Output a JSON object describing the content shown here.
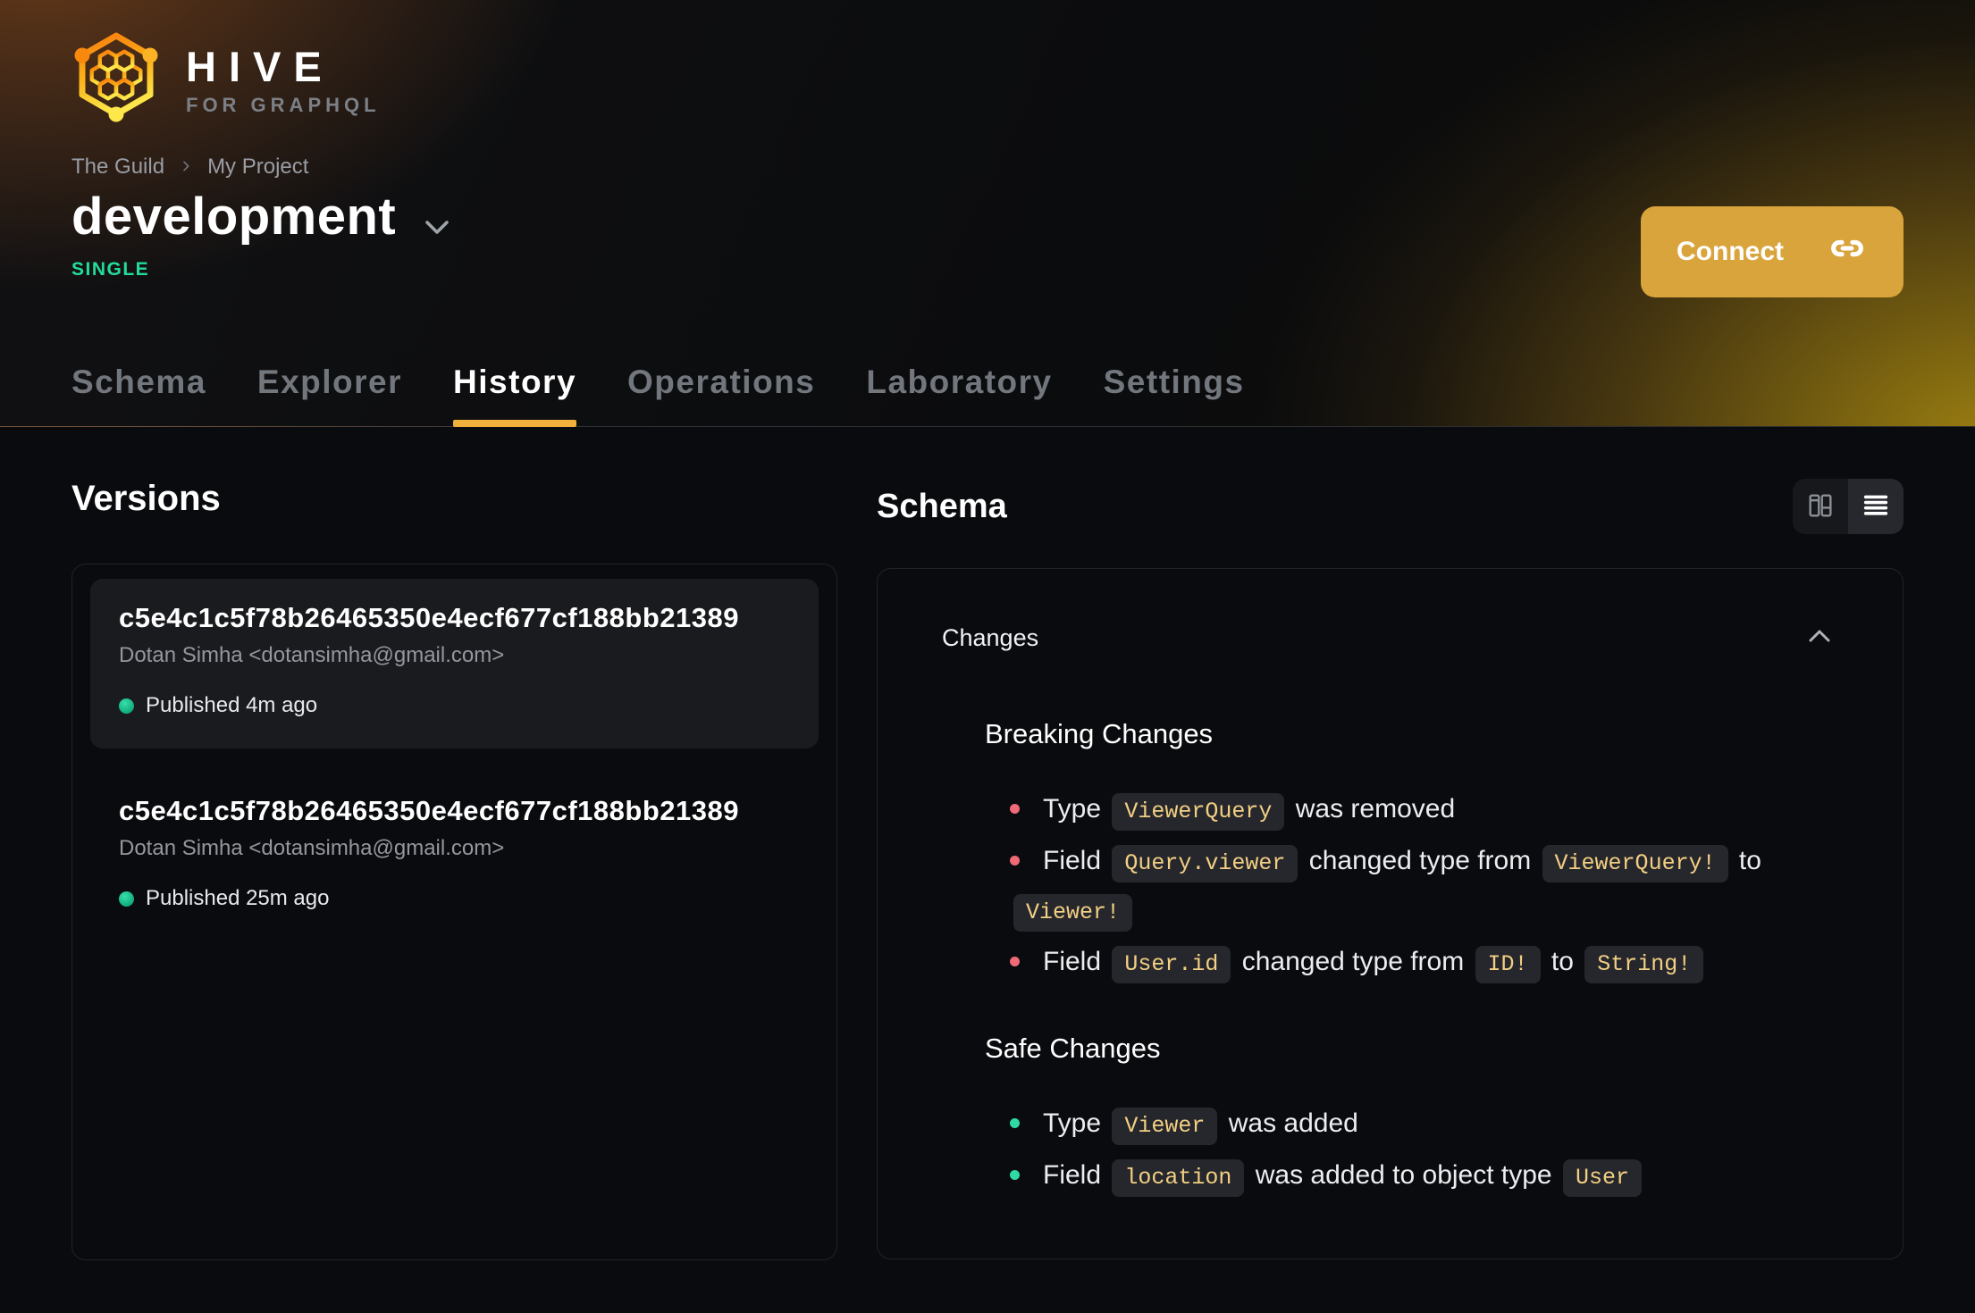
{
  "brand": {
    "name": "HIVE",
    "tagline": "FOR GRAPHQL"
  },
  "breadcrumb": {
    "items": [
      "The Guild",
      "My Project"
    ]
  },
  "project": {
    "name": "development",
    "badge": "SINGLE"
  },
  "actions": {
    "connect_label": "Connect"
  },
  "tabs": [
    {
      "label": "Schema",
      "active": false
    },
    {
      "label": "Explorer",
      "active": false
    },
    {
      "label": "History",
      "active": true
    },
    {
      "label": "Operations",
      "active": false
    },
    {
      "label": "Laboratory",
      "active": false
    },
    {
      "label": "Settings",
      "active": false
    }
  ],
  "versions": {
    "heading": "Versions",
    "items": [
      {
        "hash": "c5e4c1c5f78b26465350e4ecf677cf188bb21389",
        "author": "Dotan Simha <dotansimha@gmail.com>",
        "status": "Published 4m ago",
        "highlighted": true
      },
      {
        "hash": "c5e4c1c5f78b26465350e4ecf677cf188bb21389",
        "author": "Dotan Simha <dotansimha@gmail.com>",
        "status": "Published 25m ago",
        "highlighted": false
      }
    ]
  },
  "schema": {
    "heading": "Schema",
    "changes_label": "Changes",
    "sections": [
      {
        "title": "Breaking Changes",
        "kind": "breaking",
        "items": [
          [
            {
              "type": "text",
              "value": "Type"
            },
            {
              "type": "code",
              "value": "ViewerQuery"
            },
            {
              "type": "text",
              "value": "was removed"
            }
          ],
          [
            {
              "type": "text",
              "value": "Field"
            },
            {
              "type": "code",
              "value": "Query.viewer"
            },
            {
              "type": "text",
              "value": "changed type from"
            },
            {
              "type": "code",
              "value": "ViewerQuery!"
            },
            {
              "type": "text",
              "value": "to"
            },
            {
              "type": "code",
              "value": "Viewer!"
            }
          ],
          [
            {
              "type": "text",
              "value": "Field"
            },
            {
              "type": "code",
              "value": "User.id"
            },
            {
              "type": "text",
              "value": "changed type from"
            },
            {
              "type": "code",
              "value": "ID!"
            },
            {
              "type": "text",
              "value": "to"
            },
            {
              "type": "code",
              "value": "String!"
            }
          ]
        ]
      },
      {
        "title": "Safe Changes",
        "kind": "safe",
        "items": [
          [
            {
              "type": "text",
              "value": "Type"
            },
            {
              "type": "code",
              "value": "Viewer"
            },
            {
              "type": "text",
              "value": "was added"
            }
          ],
          [
            {
              "type": "text",
              "value": "Field"
            },
            {
              "type": "code",
              "value": "location"
            },
            {
              "type": "text",
              "value": "was added to object type"
            },
            {
              "type": "code",
              "value": "User"
            }
          ]
        ]
      }
    ]
  },
  "icons": {
    "logo": "hive-honeycomb-logo",
    "connect": "link-icon",
    "breadcrumb_sep": "chevron-right-icon",
    "target_select": "chevron-down-icon",
    "collapse": "chevron-up-icon",
    "view_split": "columns-icon",
    "view_list": "list-icon",
    "published": "green-dot-icon"
  },
  "colors": {
    "accent_amber": "#d9a43c",
    "tab_underline": "#f0b03c",
    "badge_green": "#23dc9a",
    "breaking_bullet": "#ee6a76",
    "safe_bullet": "#2fd9a2",
    "code_text": "#f2cf83",
    "code_bg": "#26272c",
    "card_bg": "#1a1b1f",
    "page_bg": "#0a0b0e"
  }
}
